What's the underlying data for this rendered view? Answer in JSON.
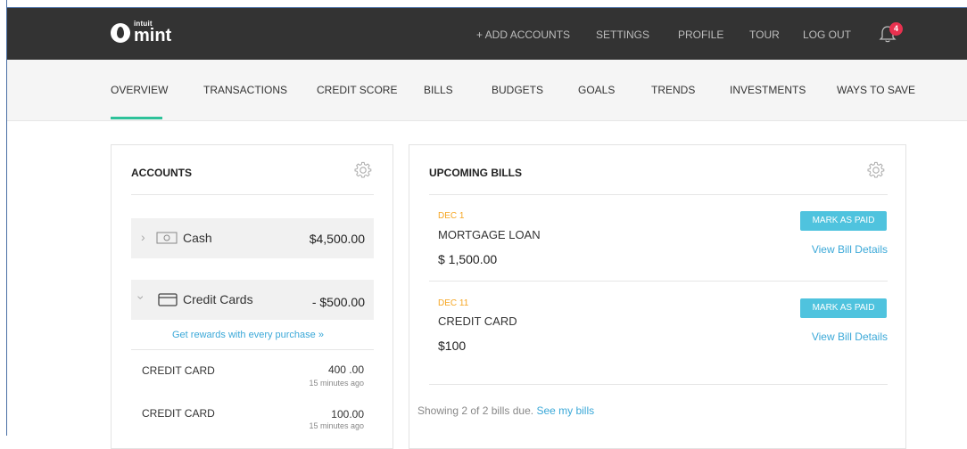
{
  "header": {
    "logo": {
      "small_text": "intuit",
      "brand_text": "mint"
    },
    "nav": [
      "+ ADD ACCOUNTS",
      "SETTINGS",
      "PROFILE",
      "TOUR",
      "LOG OUT"
    ],
    "notification_count": "4",
    "icons": {
      "logo": "mint-drop-icon",
      "notifications": "bell-icon"
    }
  },
  "subnav": {
    "items": [
      "OVERVIEW",
      "TRANSACTIONS",
      "CREDIT SCORE",
      "BILLS",
      "BUDGETS",
      "GOALS",
      "TRENDS",
      "INVESTMENTS",
      "WAYS TO SAVE"
    ],
    "active": "OVERVIEW"
  },
  "accounts": {
    "title": "ACCOUNTS",
    "cash": {
      "label": "Cash",
      "amount": "$4,500.00",
      "icon": "cash-icon"
    },
    "credit_cards": {
      "label": "Credit Cards",
      "amount": "- $500.00",
      "icon": "credit-card-icon",
      "rewards_link": "Get rewards with every purchase »",
      "items": [
        {
          "name": "CREDIT CARD",
          "value": "400 .00",
          "time": "15 minutes ago"
        },
        {
          "name": "CREDIT CARD",
          "value": "100.00",
          "time": "15 minutes ago"
        }
      ]
    }
  },
  "bills": {
    "title": "UPCOMING BILLS",
    "items": [
      {
        "date": "DEC 1",
        "name": "MORTGAGE LOAN",
        "amount": "$ 1,500.00",
        "button": "MARK AS PAID",
        "link": "View Bill Details"
      },
      {
        "date": "DEC 11",
        "name": "CREDIT CARD",
        "amount": "$100",
        "button": "MARK AS PAID",
        "link": "View Bill Details"
      }
    ],
    "footer_text": "Showing 2 of 2 bills due.",
    "footer_link": "See my bills"
  },
  "colors": {
    "topbar": "#333333",
    "accent_green": "#2ec29a",
    "button_blue": "#4fc3de",
    "link_blue": "#3aa8d8",
    "date_orange": "#f5a623",
    "badge_red": "#e8314f"
  }
}
